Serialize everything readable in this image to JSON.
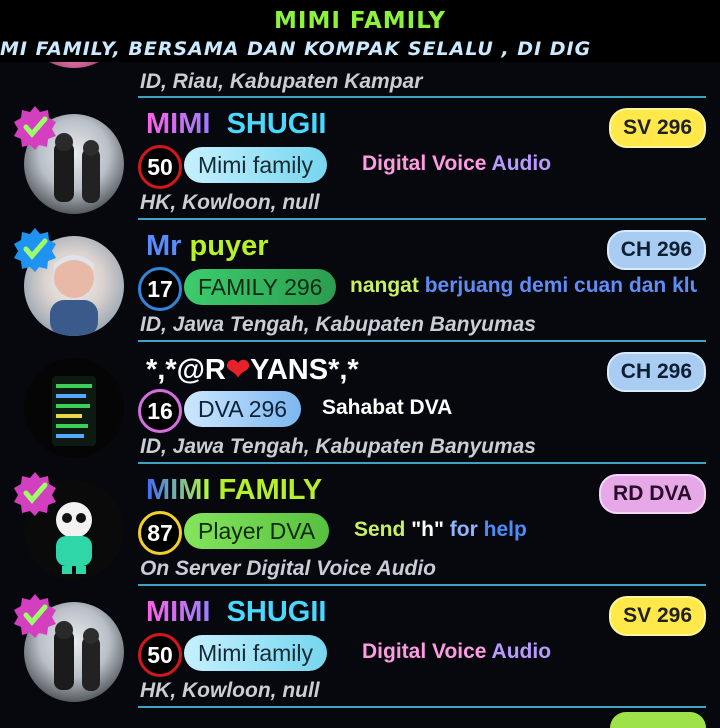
{
  "header": {
    "title": "MIMI FAMILY",
    "marquee": "MI FAMILY, BERSAMA DAN KOMPAK SELALU , DI DIG"
  },
  "top_partial": {
    "location": "ID, Riau, Kabupaten Kampar"
  },
  "rows": [
    {
      "name_a": "MIMI",
      "name_b": "SHUGII",
      "level": "50",
      "pill": "Mimi family",
      "status_a": "Digital Voice",
      "status_b": "Audio",
      "location": "HK, Kowloon, null",
      "badge": "SV 296"
    },
    {
      "name_a": "Mr",
      "name_b": "puyer",
      "level": "17",
      "pill": "FAMILY 296",
      "status_a": "nangat",
      "status_b": "berjuang demi cuan dan klu",
      "location": "ID, Jawa Tengah, Kabupaten Banyumas",
      "badge": "CH 296"
    },
    {
      "name_a": "*,*@R",
      "name_b": "YANS*,*",
      "level": "16",
      "pill": "DVA 296",
      "status_a": "Sahabat DVA",
      "location": "ID, Jawa Tengah, Kabupaten Banyumas",
      "badge": "CH 296"
    },
    {
      "name_a": "MIMI",
      "name_b": "FAMILY",
      "level": "87",
      "pill": "Player DVA",
      "status_a": "Send",
      "status_b": "\"h\"",
      "status_c": "for",
      "status_d": "help",
      "location": "On Server Digital Voice Audio",
      "badge": "RD DVA"
    },
    {
      "name_a": "MIMI",
      "name_b": "SHUGII",
      "level": "50",
      "pill": "Mimi family",
      "status_a": "Digital Voice",
      "status_b": "Audio",
      "location": "HK, Kowloon, null",
      "badge": "SV 296"
    }
  ],
  "colors": {
    "header_title": "#8df23c",
    "divider": "#3ea3c3",
    "badge_sv": "#ffe84a",
    "badge_ch": "#a9ccf3",
    "badge_rd": "#e6a8e6"
  },
  "icons": {
    "verified": "verified-badge-icon",
    "heart": "heart-icon"
  }
}
